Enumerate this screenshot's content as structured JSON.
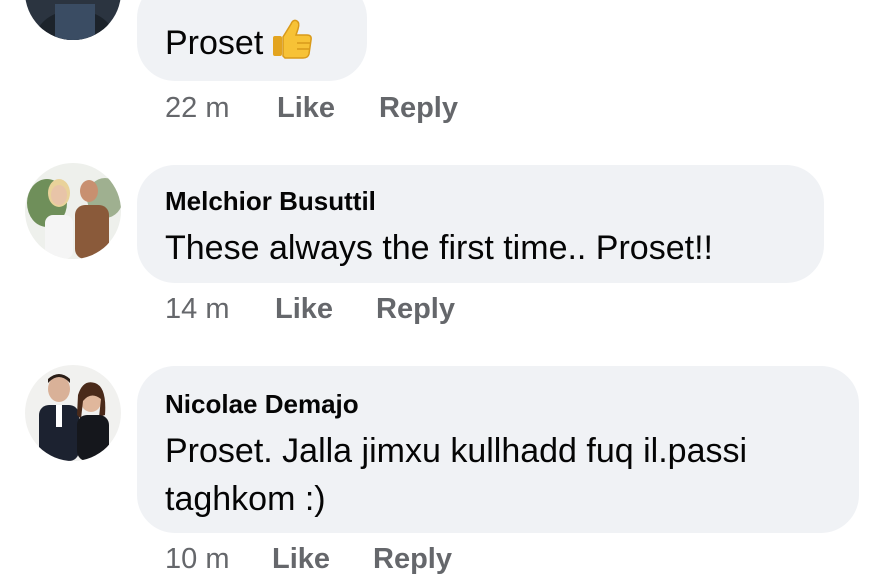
{
  "comments": [
    {
      "author": "",
      "text_lines": [
        "Proset"
      ],
      "emoji": "thumbs-up-icon",
      "time": "22 m",
      "like_label": "Like",
      "reply_label": "Reply"
    },
    {
      "author": "Melchior Busuttil",
      "text_lines": [
        "These always the first time.. Proset!!"
      ],
      "time": "14 m",
      "like_label": "Like",
      "reply_label": "Reply"
    },
    {
      "author": "Nicolae Demajo",
      "text_lines": [
        "Proset. Jalla jimxu kullhadd fuq il.passi",
        "taghkom :)"
      ],
      "time": "10 m",
      "like_label": "Like",
      "reply_label": "Reply"
    }
  ],
  "colors": {
    "bubble": "#f0f2f5",
    "meta_text": "#65676b",
    "text": "#050505",
    "emoji_yellow": "#f7c236"
  }
}
